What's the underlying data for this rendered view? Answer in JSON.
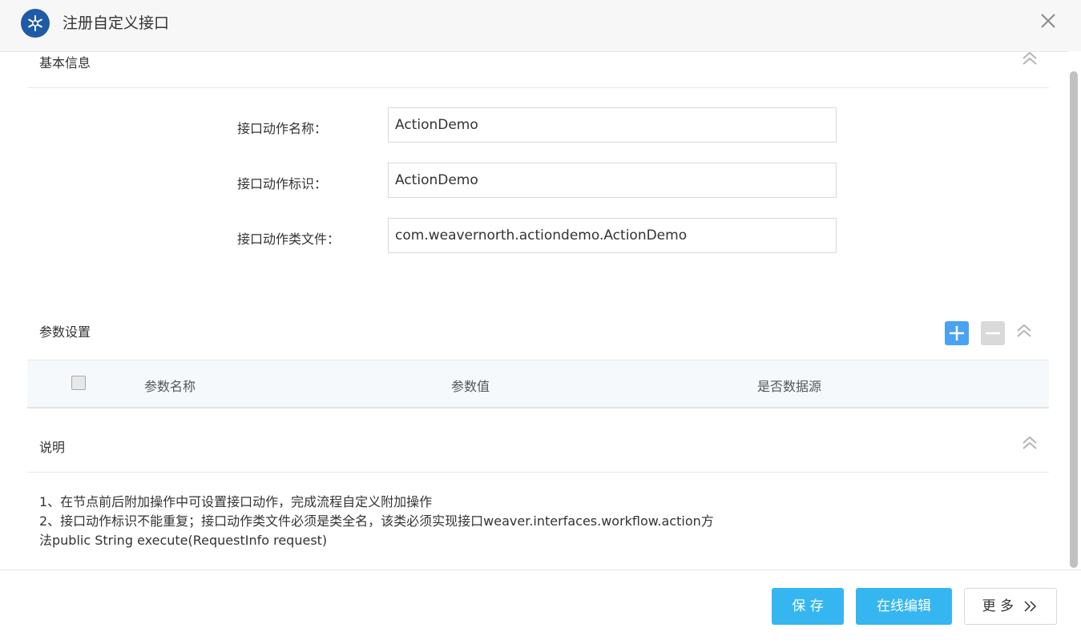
{
  "titlebar": {
    "title": "注册自定义接口",
    "app_icon": "snowflake-icon",
    "close_icon": "close-icon"
  },
  "basic_info": {
    "section_title": "基本信息",
    "fields": [
      {
        "label": "接口动作名称：",
        "value": "ActionDemo"
      },
      {
        "label": "接口动作标识：",
        "value": "ActionDemo"
      },
      {
        "label": "接口动作类文件：",
        "value": "com.weavernorth.actiondemo.ActionDemo"
      }
    ]
  },
  "params": {
    "section_title": "参数设置",
    "columns": [
      "参数名称",
      "参数值",
      "是否数据源"
    ],
    "add_icon": "plus-icon",
    "remove_icon": "minus-icon"
  },
  "description": {
    "section_title": "说明",
    "lines": [
      "1、在节点前后附加操作中可设置接口动作，完成流程自定义附加操作",
      "2、接口动作标识不能重复；接口动作类文件必须是类全名，该类必须实现接口weaver.interfaces.workflow.action方",
      "法public String execute(RequestInfo request)"
    ]
  },
  "footer": {
    "save_label": "保 存",
    "online_edit_label": "在线编辑",
    "more_label": "更 多"
  },
  "colors": {
    "primary": "#36b6f0",
    "add_button": "#4aa3f0",
    "app_icon": "#1f5aa6"
  }
}
